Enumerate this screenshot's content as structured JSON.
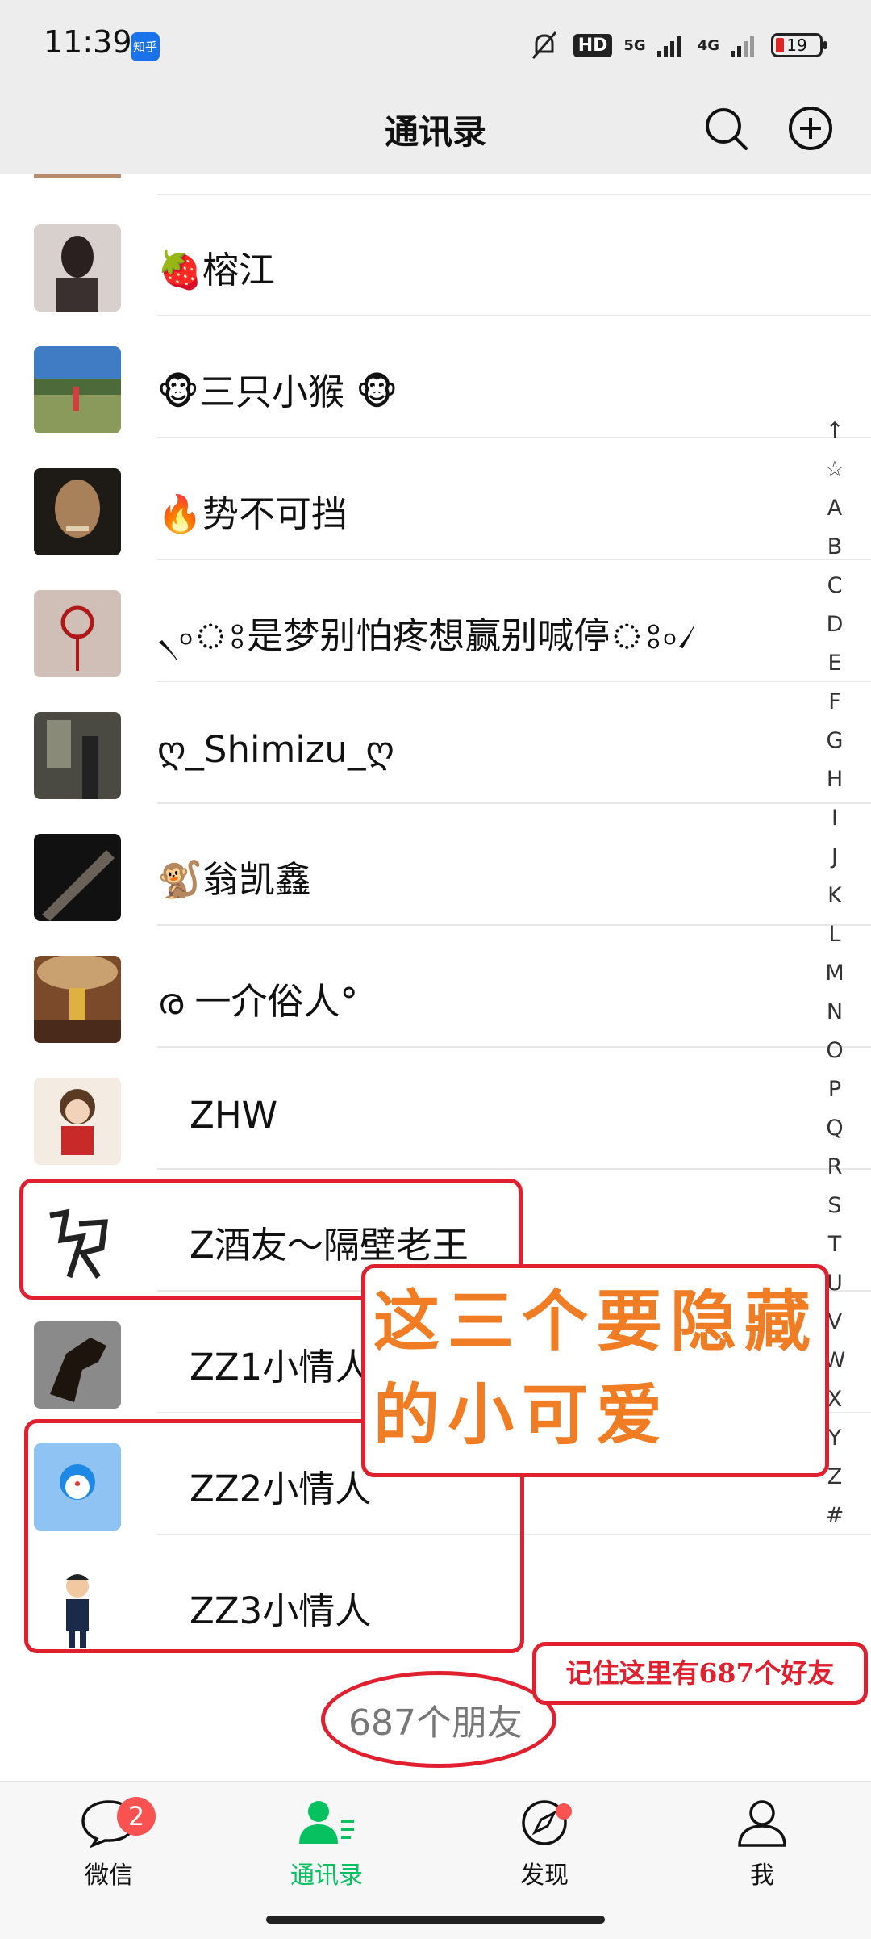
{
  "status_bar": {
    "time": "11:39",
    "app_badge": "知乎",
    "hd": "HD",
    "network1": "5G",
    "network2": "4G",
    "battery": "19"
  },
  "header": {
    "title": "通讯录",
    "search_icon": "search-icon",
    "add_icon": "plus-circle-icon"
  },
  "contacts": [
    {
      "name": "🍓榕江",
      "avatar_color": "#3a3a3a"
    },
    {
      "name": "🐵三只小猴 🐵",
      "avatar_color": "#6a8a4a"
    },
    {
      "name": "🔥势不可挡",
      "avatar_color": "#4a3a2a"
    },
    {
      "name": "৲৹ঃ是梦别怕疼想赢别喊停ঃ৹৴",
      "avatar_color": "#c8b4a8"
    },
    {
      "name": "ღ_Shimizu_ღ",
      "avatar_color": "#5a5a50"
    },
    {
      "name": "🐒翁凯鑫",
      "avatar_color": "#1c1c1c"
    },
    {
      "name": "ര 一介俗人°",
      "avatar_color": "#8a5a3a"
    },
    {
      "name": "ZHW",
      "avatar_color": "#f3e6d8"
    },
    {
      "name": "Z酒友～隔壁老王",
      "avatar_color": "#ffffff"
    },
    {
      "name": "ZZ1小情人",
      "avatar_color": "#3c3024"
    },
    {
      "name": "ZZ2小情人",
      "avatar_color": "#8fc3f4"
    },
    {
      "name": "ZZ3小情人",
      "avatar_color": "#ffffff"
    }
  ],
  "index_letters": [
    "↑",
    "☆",
    "A",
    "B",
    "C",
    "D",
    "E",
    "F",
    "G",
    "H",
    "I",
    "J",
    "K",
    "L",
    "M",
    "N",
    "O",
    "P",
    "Q",
    "R",
    "S",
    "T",
    "U",
    "V",
    "W",
    "X",
    "Y",
    "Z",
    "#"
  ],
  "annotations": {
    "big_note_line1": "这三个要隐藏",
    "big_note_line2": "的小可爱",
    "small_note": "记住这里有687个好友"
  },
  "friend_count": "687个朋友",
  "tabs": [
    {
      "label": "微信",
      "badge": "2"
    },
    {
      "label": "通讯录"
    },
    {
      "label": "发现"
    },
    {
      "label": "我"
    }
  ],
  "colors": {
    "accent": "#07c160",
    "badge": "#fa5151",
    "annotation_red": "#e0202f",
    "annotation_orange": "#f07c24"
  }
}
